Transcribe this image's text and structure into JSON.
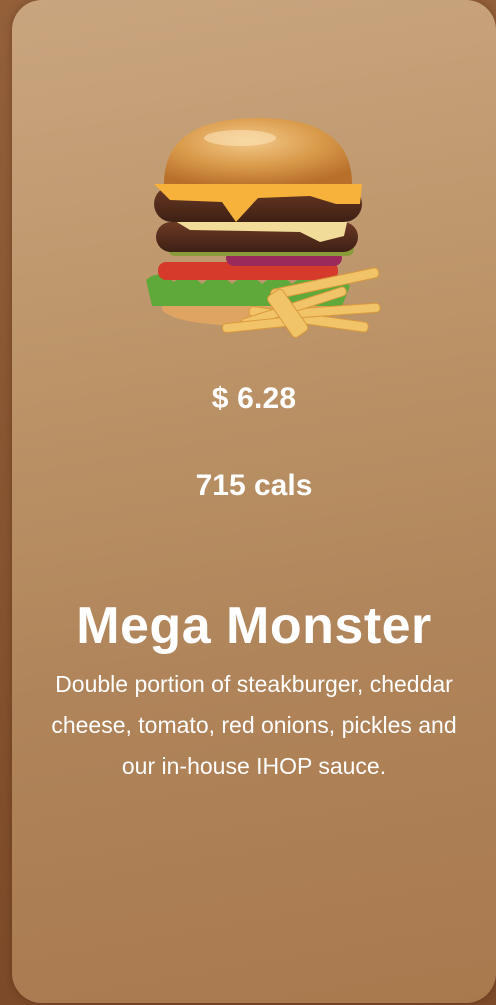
{
  "item": {
    "image_icon": "burger-with-fries-illustration",
    "price": "$ 6.28",
    "calories": "715 cals",
    "name": "Mega Monster",
    "description": "Double portion of steakburger, cheddar cheese, tomato, red onions, pickles and our in-house IHOP sauce."
  },
  "colors": {
    "card_top": "#c9a57f",
    "card_bottom": "#a9794e",
    "page_background": "#8a5530",
    "text": "#ffffff"
  }
}
